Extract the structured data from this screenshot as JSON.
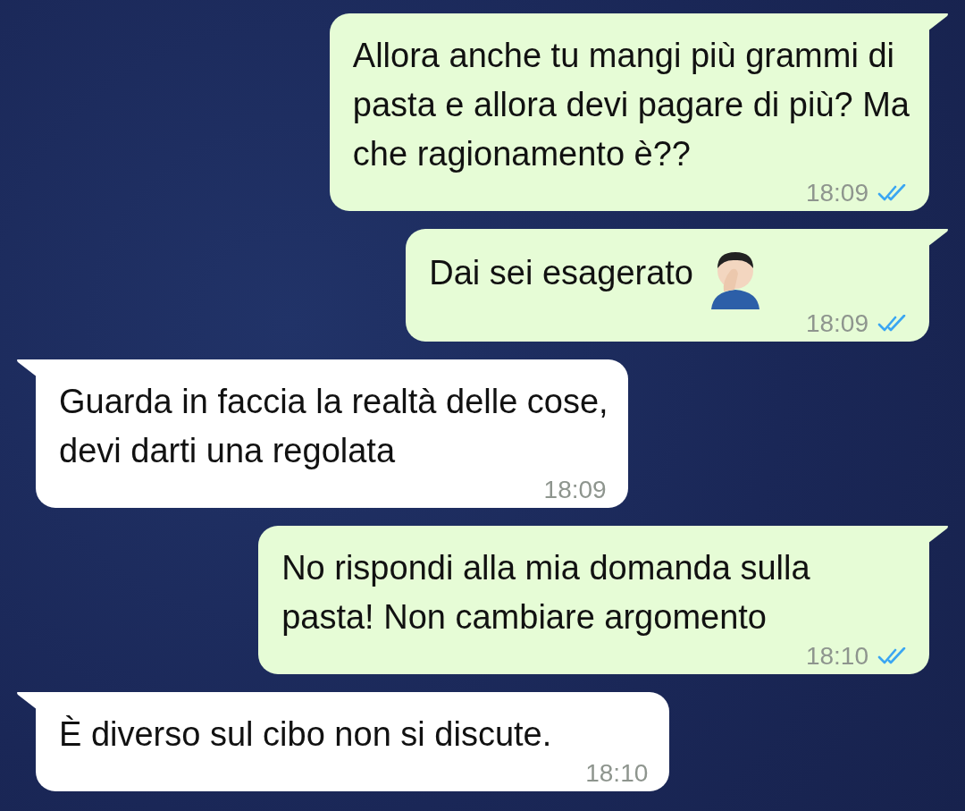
{
  "messages": [
    {
      "kind": "outgoing",
      "text": "Allora anche tu mangi più grammi di\npasta e allora devi pagare di più? Ma\nche ragionamento è??",
      "time": "18:09",
      "read": true
    },
    {
      "kind": "outgoing",
      "text": "Dai sei esagerato",
      "emoji": true,
      "time": "18:09",
      "read": true
    },
    {
      "kind": "incoming",
      "text": "Guarda in faccia la realtà delle cose,\ndevi darti una regolata",
      "time": "18:09"
    },
    {
      "kind": "outgoing",
      "text": "No rispondi alla mia domanda sulla\npasta! Non cambiare argomento",
      "time": "18:10",
      "read": true
    },
    {
      "kind": "incoming",
      "text": "È diverso sul cibo non si discute.",
      "time": "18:10"
    }
  ]
}
